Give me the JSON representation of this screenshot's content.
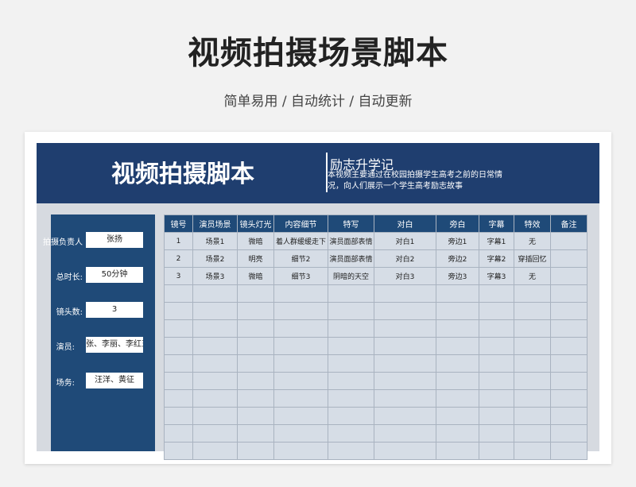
{
  "page": {
    "title": "视频拍摄场景脚本",
    "subtitle": "简单易用 / 自动统计 / 自动更新"
  },
  "banner": {
    "title": "视频拍摄脚本",
    "subtitle": "励志升学记",
    "description": "本视频主要通过在校园拍摄学生高考之前的日常情况，向人们展示一个学生高考励志故事"
  },
  "fields": [
    {
      "label": "拍摄负责人",
      "value": "张扬"
    },
    {
      "label": "总时长:",
      "value": "50分钟"
    },
    {
      "label": "镜头数:",
      "value": "3"
    },
    {
      "label": "演员:",
      "value": "张、李丽、李红王"
    },
    {
      "label": "场务:",
      "value": "汪洋、黄征"
    }
  ],
  "table": {
    "columns": [
      "镜号",
      "演员场景",
      "镜头灯光",
      "内容细节",
      "特写",
      "对白",
      "旁白",
      "字幕",
      "特效",
      "备注"
    ],
    "rows": [
      [
        "1",
        "场景1",
        "微暗",
        "着人群缓缓走下",
        "演员面部表情",
        "对白1",
        "旁边1",
        "字幕1",
        "无",
        ""
      ],
      [
        "2",
        "场景2",
        "明亮",
        "细节2",
        "演员面部表情",
        "对白2",
        "旁边2",
        "字幕2",
        "穿插回忆",
        ""
      ],
      [
        "3",
        "场景3",
        "微暗",
        "细节3",
        "阴暗的天空",
        "对白3",
        "旁边3",
        "字幕3",
        "无",
        ""
      ]
    ]
  }
}
